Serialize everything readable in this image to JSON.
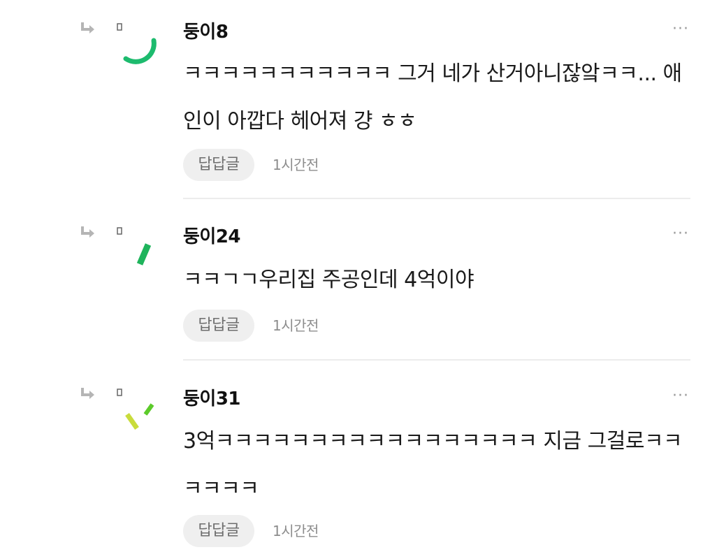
{
  "comments": [
    {
      "author": "둥이8",
      "text": "ㅋㅋㅋㅋㅋㅋㅋㅋㅋㅋㅋ 그거 네가 산거아니잖앜ㅋㅋ... 애인이 아깝다 헤어져 걍 ㅎㅎ",
      "reply_label": "답답글",
      "time": "1시간전",
      "more_label": "···",
      "avatar_icon": "green-arc-avatar-icon"
    },
    {
      "author": "둥이24",
      "text": "ㅋㅋㄱㄱ우리집 주공인데 4억이야",
      "reply_label": "답답글",
      "time": "1시간전",
      "more_label": "···",
      "avatar_icon": "green-stroke-avatar-icon"
    },
    {
      "author": "둥이31",
      "text": "3억ㅋㅋㅋㅋㅋㅋㅋㅋㅋㅋㅋㅋㅋㅋㅋㅋㅋ 지금 그걸로ㅋㅋㅋㅋㅋㅋ",
      "reply_label": "답답글",
      "time": "1시간전",
      "more_label": "···",
      "avatar_icon": "lime-strokes-avatar-icon"
    }
  ],
  "colors": {
    "avatar_green": "#1dbb6e",
    "avatar_dark_green": "#1fb45c",
    "avatar_lime": "#c9dc3c",
    "avatar_lime_green": "#5ccb2a",
    "reply_button_bg": "#efefef",
    "divider": "#ececec"
  },
  "icons": {
    "reply_arrow": "reply-arrow-icon",
    "small_marker": "small-square-icon",
    "more": "more-dots-icon"
  }
}
